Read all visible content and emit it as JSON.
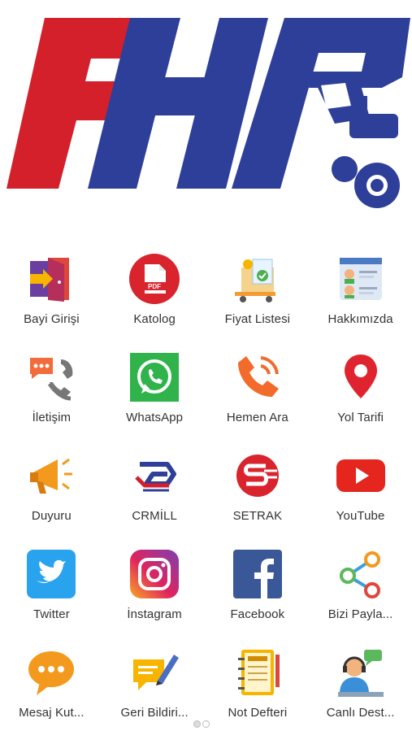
{
  "logo": {
    "text": "FHR",
    "red": "#d3202b",
    "blue": "#2e3f99"
  },
  "tiles": [
    {
      "label": "Bayi Girişi",
      "icon": "login-door-icon"
    },
    {
      "label": "Katolog",
      "icon": "pdf-icon"
    },
    {
      "label": "Fiyat Listesi",
      "icon": "price-cart-icon"
    },
    {
      "label": "Hakkımızda",
      "icon": "about-profile-icon"
    },
    {
      "label": "İletişim",
      "icon": "contact-phone-chat-icon"
    },
    {
      "label": "WhatsApp",
      "icon": "whatsapp-icon"
    },
    {
      "label": "Hemen Ara",
      "icon": "call-phone-icon"
    },
    {
      "label": "Yol Tarifi",
      "icon": "map-pin-icon"
    },
    {
      "label": "Duyuru",
      "icon": "megaphone-icon"
    },
    {
      "label": "CRMİLL",
      "icon": "crmill-logo-icon"
    },
    {
      "label": "SETRAK",
      "icon": "setrak-logo-icon"
    },
    {
      "label": "YouTube",
      "icon": "youtube-icon"
    },
    {
      "label": "Twitter",
      "icon": "twitter-icon"
    },
    {
      "label": "İnstagram",
      "icon": "instagram-icon"
    },
    {
      "label": "Facebook",
      "icon": "facebook-icon"
    },
    {
      "label": "Bizi Payla...",
      "icon": "share-icon"
    },
    {
      "label": "Mesaj Kut...",
      "icon": "message-bubble-icon"
    },
    {
      "label": "Geri Bildiri...",
      "icon": "feedback-pen-icon"
    },
    {
      "label": "Not Defteri",
      "icon": "notebook-icon"
    },
    {
      "label": "Canlı Dest...",
      "icon": "live-support-icon"
    }
  ],
  "pager": {
    "count": 2,
    "active": 0
  }
}
